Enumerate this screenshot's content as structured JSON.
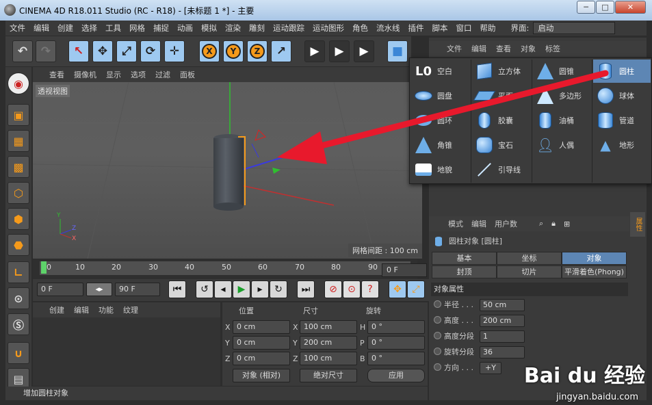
{
  "window": {
    "title": "CINEMA 4D R18.011 Studio (RC - R18) - [未标题 1 *] - 主要",
    "min": "─",
    "max": "□",
    "close": "✕"
  },
  "menu": [
    "文件",
    "编辑",
    "创建",
    "选择",
    "工具",
    "网格",
    "捕捉",
    "动画",
    "模拟",
    "渲染",
    "雕刻",
    "运动跟踪",
    "运动图形",
    "角色",
    "流水线",
    "插件",
    "脚本",
    "窗口",
    "帮助"
  ],
  "layout_label": "界面:",
  "layout_value": "启动",
  "toolbar": {
    "undo": "↶",
    "redo": "↷",
    "live_select": "↖",
    "move": "✥",
    "scale": "⤢",
    "rotate": "⟳",
    "move2": "✛",
    "x": "X",
    "y": "Y",
    "z": "Z",
    "coord": "↗",
    "render1": "▶",
    "render2": "▶",
    "render3": "▶",
    "cube": "■",
    "pen": "✎"
  },
  "viewport_menu": [
    "查看",
    "摄像机",
    "显示",
    "选项",
    "过滤",
    "面板"
  ],
  "viewport_label": "透视视图",
  "grid_spacing": "网格间距 : 100 cm",
  "timeline_ticks": [
    "0",
    "10",
    "20",
    "30",
    "40",
    "50",
    "60",
    "70",
    "80",
    "90"
  ],
  "timeline_frame": "0 F",
  "controls": {
    "start": "0 F",
    "end": "90 F"
  },
  "object_menu": [
    "创建",
    "编辑",
    "功能",
    "纹理"
  ],
  "coords": {
    "headers": [
      "位置",
      "尺寸",
      "旋转"
    ],
    "pos": [
      {
        "axis": "X",
        "val": "0 cm"
      },
      {
        "axis": "Y",
        "val": "0 cm"
      },
      {
        "axis": "Z",
        "val": "0 cm"
      }
    ],
    "size": [
      {
        "axis": "X",
        "val": "100 cm"
      },
      {
        "axis": "Y",
        "val": "200 cm"
      },
      {
        "axis": "Z",
        "val": "100 cm"
      }
    ],
    "rot": [
      {
        "axis": "H",
        "val": "0 °"
      },
      {
        "axis": "P",
        "val": "0 °"
      },
      {
        "axis": "B",
        "val": "0 °"
      }
    ],
    "mode": "对象 (相对)",
    "size_mode": "绝对尺寸",
    "apply": "应用"
  },
  "status": "增加圆柱对象",
  "right_menu": [
    "文件",
    "编辑",
    "查看",
    "对象",
    "标签"
  ],
  "attr_menu": [
    "模式",
    "编辑",
    "用户数"
  ],
  "attr_title": "圆柱对象 [圆柱]",
  "attr_tabs": [
    "基本",
    "坐标",
    "对象",
    "封顶",
    "切片",
    "平滑着色(Phong)"
  ],
  "attr_section": "对象属性",
  "props": [
    {
      "label": "半径 . . .",
      "value": "50 cm"
    },
    {
      "label": "高度 . . .",
      "value": "200 cm"
    },
    {
      "label": "高度分段",
      "value": "1"
    },
    {
      "label": "旋转分段",
      "value": "36"
    },
    {
      "label": "方向 . . .",
      "value": "+Y"
    }
  ],
  "side_tab": "属性",
  "popup": [
    {
      "label": "空白",
      "icon": "null"
    },
    {
      "label": "立方体",
      "icon": "cube"
    },
    {
      "label": "圆锥",
      "icon": "cone"
    },
    {
      "label": "圆柱",
      "icon": "cylinder"
    },
    {
      "label": "圆盘",
      "icon": "disc"
    },
    {
      "label": "平面",
      "icon": "plane"
    },
    {
      "label": "多边形",
      "icon": "polygon"
    },
    {
      "label": "球体",
      "icon": "sphere"
    },
    {
      "label": "圆环",
      "icon": "torus"
    },
    {
      "label": "胶囊",
      "icon": "capsule"
    },
    {
      "label": "油桶",
      "icon": "oiltank"
    },
    {
      "label": "管道",
      "icon": "tube"
    },
    {
      "label": "角锥",
      "icon": "pyramid"
    },
    {
      "label": "宝石",
      "icon": "gem"
    },
    {
      "label": "人偶",
      "icon": "figure"
    },
    {
      "label": "地形",
      "icon": "landscape"
    },
    {
      "label": "地貌",
      "icon": "relief"
    },
    {
      "label": "引导线",
      "icon": "guide"
    }
  ],
  "watermark": {
    "main": "Bai du 经验",
    "sub": "jingyan.baidu.com"
  },
  "colors": {
    "accent": "#f59a1b",
    "select": "#5d86b4",
    "arrow": "#e8192c"
  }
}
